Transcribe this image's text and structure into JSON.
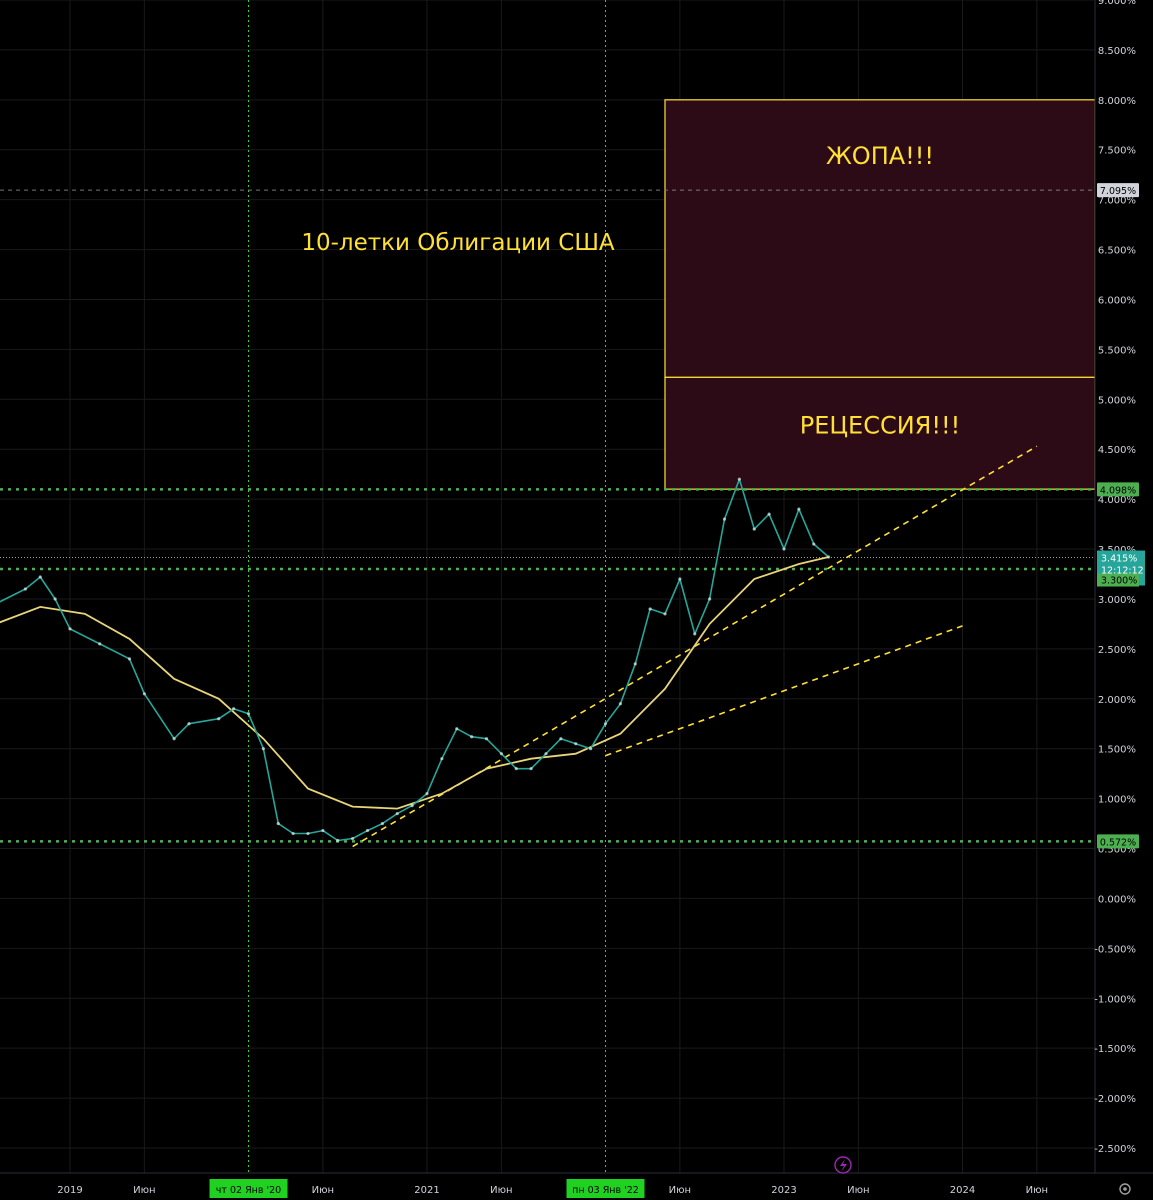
{
  "chart_data": {
    "type": "line",
    "series": [
      {
        "values_x": [
          "2018-08",
          "2018-10",
          "2018-11",
          "2018-12",
          "2019-01",
          "2019-03",
          "2019-05",
          "2019-06",
          "2019-08",
          "2019-09",
          "2019-11",
          "2019-12",
          "2020-01",
          "2020-02",
          "2020-03",
          "2020-04",
          "2020-05",
          "2020-06",
          "2020-07",
          "2020-08",
          "2020-09",
          "2020-10",
          "2020-11",
          "2020-12",
          "2021-01",
          "2021-02",
          "2021-03",
          "2021-04",
          "2021-05",
          "2021-06",
          "2021-07",
          "2021-08",
          "2021-09",
          "2021-10",
          "2021-11",
          "2021-12",
          "2022-01",
          "2022-02",
          "2022-03",
          "2022-04",
          "2022-05",
          "2022-06",
          "2022-07",
          "2022-08",
          "2022-09",
          "2022-10",
          "2022-11",
          "2022-12",
          "2023-01",
          "2023-02",
          "2023-03",
          "2023-04"
        ],
        "values": [
          2.95,
          3.1,
          3.22,
          3.0,
          2.7,
          2.55,
          2.4,
          2.05,
          1.6,
          1.75,
          1.8,
          1.9,
          1.85,
          1.5,
          0.75,
          0.65,
          0.65,
          0.68,
          0.58,
          0.6,
          0.68,
          0.75,
          0.85,
          0.93,
          1.05,
          1.4,
          1.7,
          1.62,
          1.6,
          1.45,
          1.3,
          1.3,
          1.45,
          1.6,
          1.55,
          1.5,
          1.75,
          1.95,
          2.35,
          2.9,
          2.85,
          3.2,
          2.65,
          3.0,
          3.8,
          4.2,
          3.7,
          3.85,
          3.5,
          3.9,
          3.55,
          3.42
        ]
      },
      {
        "values_x": [
          "2018-08",
          "2018-11",
          "2019-02",
          "2019-05",
          "2019-08",
          "2019-11",
          "2020-02",
          "2020-05",
          "2020-08",
          "2020-11",
          "2021-02",
          "2021-05",
          "2021-08",
          "2021-11",
          "2022-02",
          "2022-05",
          "2022-08",
          "2022-11",
          "2023-02",
          "2023-04"
        ],
        "values": [
          2.75,
          2.92,
          2.85,
          2.6,
          2.2,
          2.0,
          1.6,
          1.1,
          0.92,
          0.9,
          1.05,
          1.3,
          1.4,
          1.45,
          1.65,
          2.1,
          2.75,
          3.2,
          3.35,
          3.42
        ]
      }
    ],
    "ylim": [
      -2.7,
      9.0
    ],
    "y_ticks": [
      "9.000%",
      "8.500%",
      "8.000%",
      "7.500%",
      "7.000%",
      "6.500%",
      "6.000%",
      "5.500%",
      "5.000%",
      "4.500%",
      "4.000%",
      "3.500%",
      "3.000%",
      "2.500%",
      "2.000%",
      "1.500%",
      "1.000%",
      "0.500%",
      "0.000%",
      "-0.500%",
      "-1.000%",
      "-1.500%",
      "-2.000%",
      "-2.500%"
    ],
    "y_tick_values": [
      9.0,
      8.5,
      8.0,
      7.5,
      7.0,
      6.5,
      6.0,
      5.5,
      5.0,
      4.5,
      4.0,
      3.5,
      3.0,
      2.5,
      2.0,
      1.5,
      1.0,
      0.5,
      0.0,
      -0.5,
      -1.0,
      -1.5,
      -2.0,
      -2.5
    ],
    "x_ticks": [
      "2019",
      "Июн",
      "Июн",
      "2021",
      "Июн",
      "Июн",
      "2023",
      "Июн",
      "2024",
      "Июн"
    ],
    "x_tick_dates": [
      "2019-01",
      "2019-06",
      "2020-06",
      "2021-01",
      "2021-06",
      "2022-06",
      "2023-01",
      "2023-06",
      "2024-01",
      "2024-06"
    ],
    "x_highlight_labels": [
      "чт 02 Янв '20",
      "пн 03 Янв '22"
    ],
    "x_highlight_dates": [
      "2020-01",
      "2022-01"
    ],
    "horizontal_levels": [
      4.098,
      3.3,
      0.572
    ],
    "price_tags": {
      "level_high": "4.098%",
      "level_mid": "3.300%",
      "level_low": "0.572%",
      "current": "3.415%",
      "countdown": "12:12:12",
      "dashed": "7.095%"
    },
    "zones": [
      {
        "label": "ЖОПА!!!",
        "y_from": 5.22,
        "y_to": 8.0
      },
      {
        "label": "РЕЦЕССИЯ!!!",
        "y_from": 4.1,
        "y_to": 5.22
      }
    ],
    "trendlines": [
      {
        "from_date": "2020-08",
        "from_value": 0.52,
        "to_date": "2024-06",
        "to_value": 4.53
      },
      {
        "from_date": "2022-01",
        "from_value": 1.43,
        "to_date": "2024-01",
        "to_value": 2.73
      }
    ],
    "annotation": "10-летки Облигации США",
    "colors": {
      "background": "#000000",
      "grid": "#1a1a1a",
      "price": "#26a69a",
      "ma": "#e8d57a",
      "level": "#4caf50",
      "zone_fill": "#2c0a16",
      "zone_border": "#ffe135",
      "annotation": "#ffe135"
    }
  }
}
